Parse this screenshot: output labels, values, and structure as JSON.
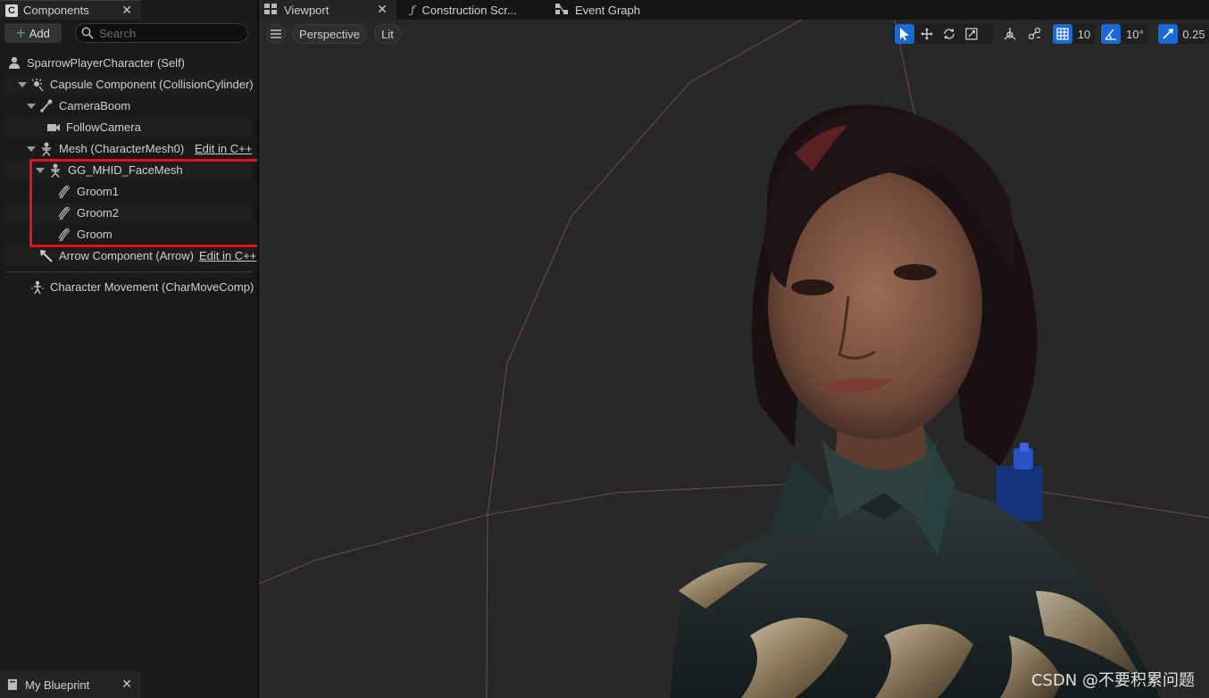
{
  "components_panel": {
    "tab_label": "Components",
    "tab_icon_glyph": "C",
    "add_label": "Add",
    "search_placeholder": "Search",
    "tree": [
      {
        "label": "SparrowPlayerCharacter (Self)",
        "icon": "character-icon"
      },
      {
        "label": "Capsule Component (CollisionCylinder)",
        "icon": "capsule-icon"
      },
      {
        "label": "CameraBoom",
        "icon": "spring-arm-icon"
      },
      {
        "label": "FollowCamera",
        "icon": "camera-icon"
      },
      {
        "label": "Mesh (CharacterMesh0)",
        "icon": "skeletal-mesh-icon",
        "edit_link": "Edit in C++"
      },
      {
        "label": "GG_MHID_FaceMesh",
        "icon": "skeletal-mesh-icon"
      },
      {
        "label": "Groom1",
        "icon": "groom-icon"
      },
      {
        "label": "Groom2",
        "icon": "groom-icon"
      },
      {
        "label": "Groom",
        "icon": "groom-icon"
      },
      {
        "label": "Arrow Component (Arrow)",
        "icon": "arrow-icon",
        "edit_link": "Edit in C++"
      },
      {
        "label": "Character Movement (CharMoveComp)",
        "icon": "movement-icon"
      }
    ],
    "highlight_color": "#e8101d"
  },
  "my_blueprint_tab": {
    "label": "My Blueprint"
  },
  "editor_tabs": [
    {
      "label": "Viewport",
      "icon": "viewport-grid-icon"
    },
    {
      "label": "Construction Scr...",
      "icon": "function-icon"
    },
    {
      "label": "Event Graph",
      "icon": "event-graph-icon"
    }
  ],
  "viewport": {
    "view_mode": "Perspective",
    "lighting_mode": "Lit",
    "grid_snap": "10",
    "rotation_snap": "10°",
    "scale_snap": "0.25",
    "accent_color": "#1a6ad6",
    "watermark": "CSDN @不要积累问题"
  }
}
